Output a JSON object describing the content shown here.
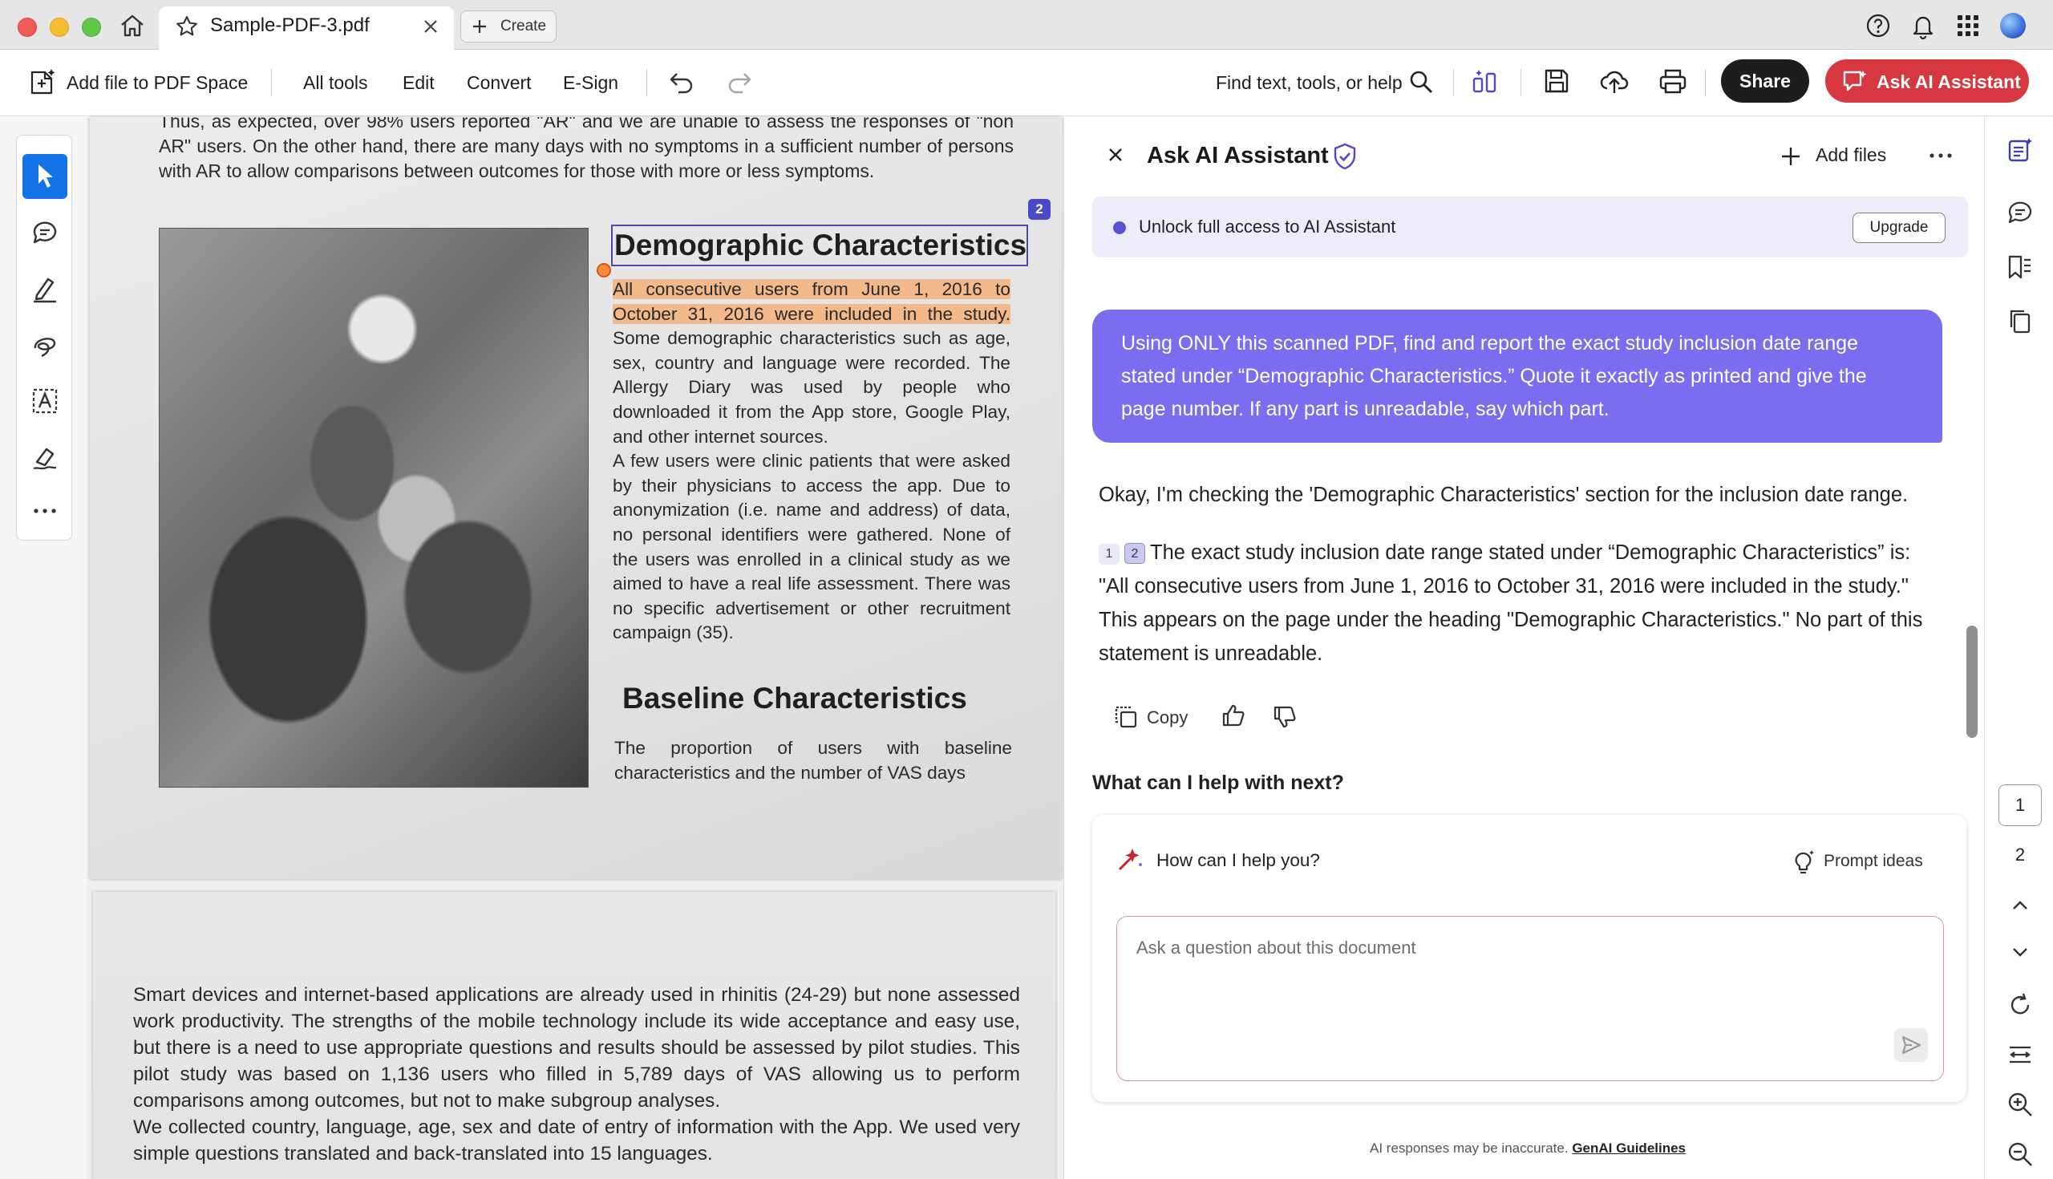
{
  "window": {
    "tab_title": "Sample-PDF-3.pdf",
    "create_label": "Create"
  },
  "toolbar": {
    "add_file": "Add file to PDF Space",
    "all_tools": "All tools",
    "edit": "Edit",
    "convert": "Convert",
    "esign": "E-Sign",
    "search_label": "Find text, tools, or help",
    "share": "Share",
    "ask_ai": "Ask AI Assistant"
  },
  "document": {
    "top_paragraph": "Thus, as expected, over 98% users reported \"AR\" and we are unable to assess the responses of \"non AR\" users. On the other hand, there are many days with no symptoms in a sufficient number of persons with AR to allow comparisons between outcomes for those with more or less symptoms.",
    "heading_demographic": "Demographic Characteristics",
    "citation_badge": "2",
    "demo_highlight": "All consecutive users from June 1, 2016 to October 31, 2016 were included in the study.",
    "demo_rest": " Some demographic characteristics such as age, sex, country and language were recorded. The Allergy Diary was used by people who downloaded it from the App store, Google Play, and other internet sources.",
    "demo_paragraph2": "A few users were clinic patients that were asked by their physicians to access the app. Due to anonymization (i.e. name and address) of data, no personal identifiers were gathered. None of the users was enrolled in a clinical study as we aimed to have a real life assessment. There was no specific advertisement or other recruitment campaign (35).",
    "heading_baseline": "Baseline Characteristics",
    "baseline_paragraph": "The proportion of users with baseline characteristics and the number of VAS days",
    "bottom_paragraph1": "Smart devices and internet-based applications are already used in rhinitis (24-29) but none assessed work productivity. The strengths of the mobile technology include its wide acceptance and easy use, but there is a need to use appropriate questions and results should be assessed by pilot studies. This pilot study was based on 1,136 users who filled in 5,789 days of VAS allowing us to perform comparisons among outcomes, but not to make subgroup analyses.",
    "bottom_paragraph2": "We collected country, language, age, sex and date of entry of information with the App. We used very simple questions translated and back-translated into 15 languages."
  },
  "ai_panel": {
    "title": "Ask AI Assistant",
    "add_files": "Add files",
    "banner_text": "Unlock full access to AI Assistant",
    "upgrade": "Upgrade",
    "user_message": "Using ONLY this scanned PDF, find and report the exact study inclusion date range stated under “Demographic Characteristics.” Quote it exactly as printed and give the page number. If any part is unreadable, say which part.",
    "response_intro": "Okay, I'm checking the 'Demographic Characteristics' section for the inclusion date range.",
    "cite_1": "1",
    "cite_2": "2",
    "response_body": "The exact study inclusion date range stated under “Demographic Characteristics” is: \"All consecutive users from June 1, 2016 to October 31, 2016 were included in the study.\" This appears on the page under the heading \"Demographic Characteristics.\" No part of this statement is unreadable.",
    "copy": "Copy",
    "help_next": "What can I help with next?",
    "how_help": "How can I help you?",
    "prompt_ideas": "Prompt ideas",
    "input_placeholder": "Ask a question about this document",
    "disclaimer": "AI responses may be inaccurate.",
    "guidelines": "GenAI Guidelines"
  },
  "page_nav": {
    "page1": "1",
    "page2": "2"
  },
  "colors": {
    "accent_red": "#d7373f",
    "ai_purple": "#7a6df0",
    "highlight": "#f2b98a",
    "selection_blue": "#4a4aa8"
  }
}
